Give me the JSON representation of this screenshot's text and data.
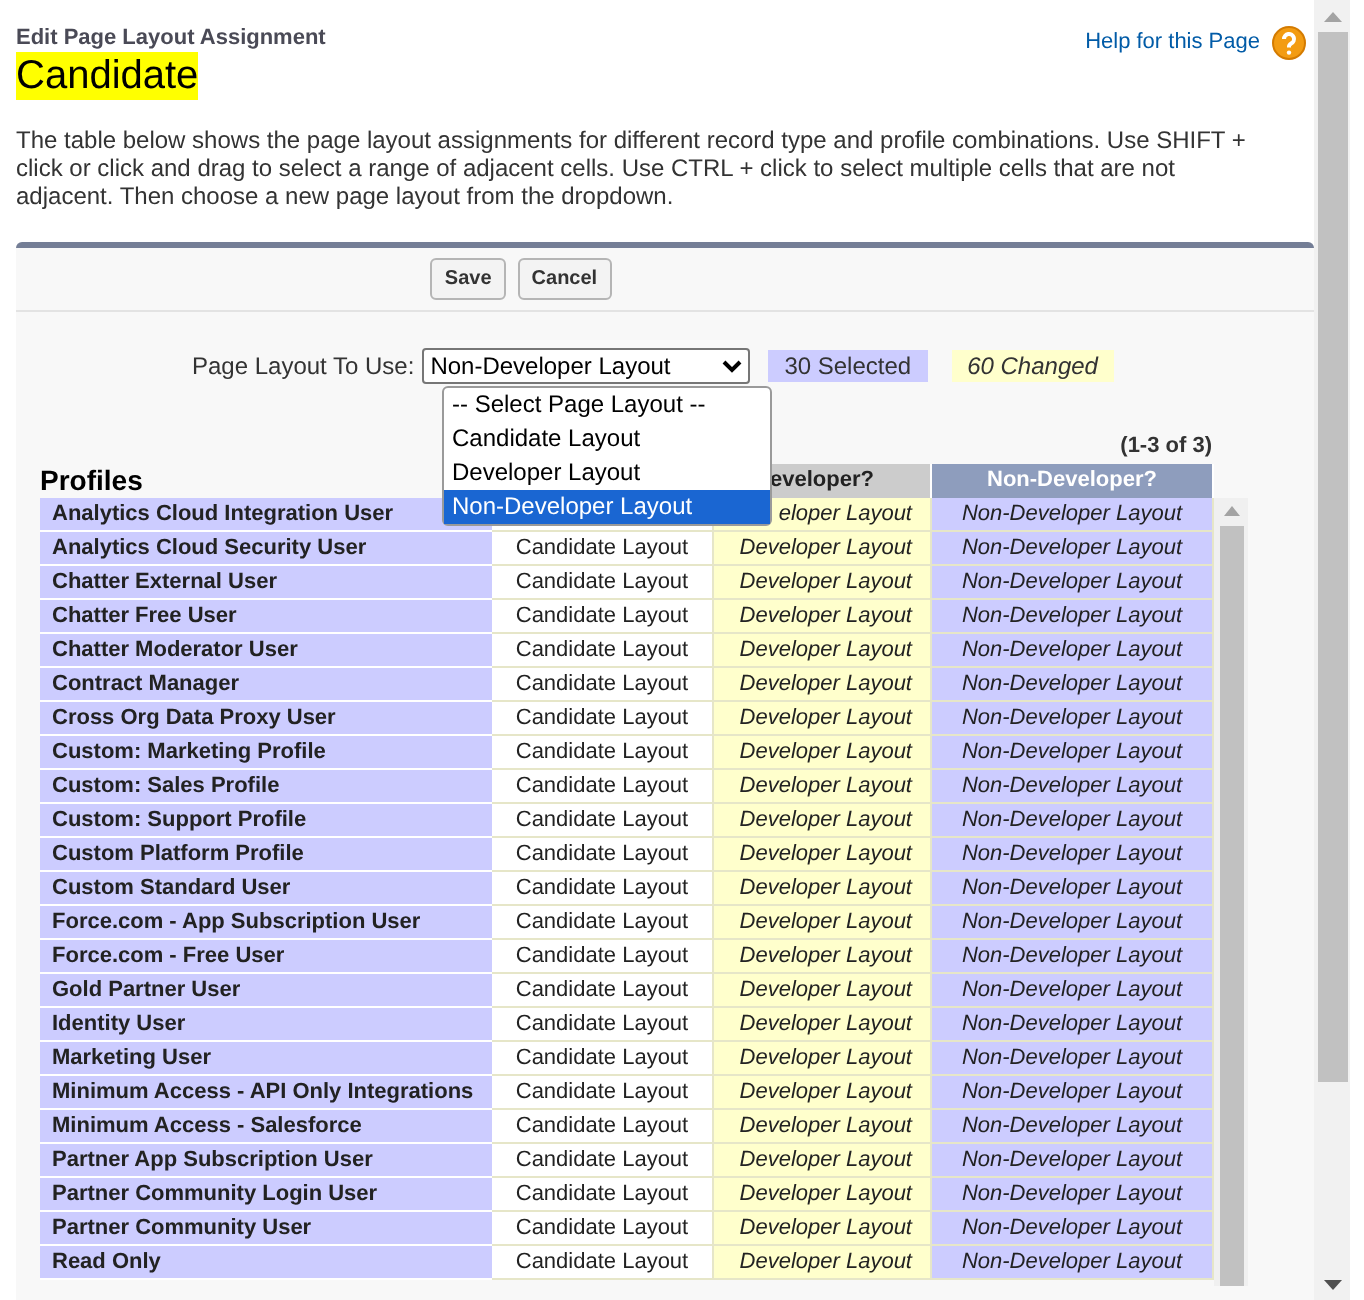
{
  "header": {
    "breadcrumb": "Edit Page Layout Assignment",
    "title": "Candidate",
    "help_link": "Help for this Page"
  },
  "description": "The table below shows the page layout assignments for different record type and profile combinations. Use SHIFT + click or click and drag to select a range of adjacent cells. Use CTRL + click to select multiple cells that are not adjacent. Then choose a new page layout from the dropdown.",
  "buttons": [
    "Save",
    "Cancel"
  ],
  "layout_picker": {
    "label": "Page Layout To Use:",
    "value": "Non-Developer Layout",
    "selected_count": "30 Selected",
    "changed_count": "60 Changed",
    "options": [
      {
        "label": "-- Select Page Layout --",
        "selected": false
      },
      {
        "label": "Candidate Layout",
        "selected": false
      },
      {
        "label": "Developer Layout",
        "selected": false
      },
      {
        "label": "Non-Developer Layout",
        "selected": true
      }
    ]
  },
  "pagination": "(1-3 of 3)",
  "table": {
    "profiles_heading": "Profiles",
    "columns": [
      {
        "selected": false,
        "changed": false
      },
      {
        "header": "eveloper?",
        "selected": false,
        "changed": true
      },
      {
        "header": "Non-Developer?",
        "selected": true,
        "changed": true
      }
    ],
    "rows": [
      {
        "profile": "Analytics Cloud Integration User",
        "cells": {
          "1": "eloper Layout",
          "2": "Non-Developer Layout"
        }
      },
      {
        "profile": "Analytics Cloud Security User",
        "cells": [
          "Candidate Layout",
          "Developer Layout",
          "Non-Developer Layout"
        ]
      },
      {
        "profile": "Chatter External User",
        "cells": [
          "Candidate Layout",
          "Developer Layout",
          "Non-Developer Layout"
        ]
      },
      {
        "profile": "Chatter Free User",
        "cells": [
          "Candidate Layout",
          "Developer Layout",
          "Non-Developer Layout"
        ]
      },
      {
        "profile": "Chatter Moderator User",
        "cells": [
          "Candidate Layout",
          "Developer Layout",
          "Non-Developer Layout"
        ]
      },
      {
        "profile": "Contract Manager",
        "cells": [
          "Candidate Layout",
          "Developer Layout",
          "Non-Developer Layout"
        ]
      },
      {
        "profile": "Cross Org Data Proxy User",
        "cells": [
          "Candidate Layout",
          "Developer Layout",
          "Non-Developer Layout"
        ]
      },
      {
        "profile": "Custom: Marketing Profile",
        "cells": [
          "Candidate Layout",
          "Developer Layout",
          "Non-Developer Layout"
        ]
      },
      {
        "profile": "Custom: Sales Profile",
        "cells": [
          "Candidate Layout",
          "Developer Layout",
          "Non-Developer Layout"
        ]
      },
      {
        "profile": "Custom: Support Profile",
        "cells": [
          "Candidate Layout",
          "Developer Layout",
          "Non-Developer Layout"
        ]
      },
      {
        "profile": "Custom Platform Profile",
        "cells": [
          "Candidate Layout",
          "Developer Layout",
          "Non-Developer Layout"
        ]
      },
      {
        "profile": "Custom Standard User",
        "cells": [
          "Candidate Layout",
          "Developer Layout",
          "Non-Developer Layout"
        ]
      },
      {
        "profile": "Force.com - App Subscription User",
        "cells": [
          "Candidate Layout",
          "Developer Layout",
          "Non-Developer Layout"
        ]
      },
      {
        "profile": "Force.com - Free User",
        "cells": [
          "Candidate Layout",
          "Developer Layout",
          "Non-Developer Layout"
        ]
      },
      {
        "profile": "Gold Partner User",
        "cells": [
          "Candidate Layout",
          "Developer Layout",
          "Non-Developer Layout"
        ]
      },
      {
        "profile": "Identity User",
        "cells": [
          "Candidate Layout",
          "Developer Layout",
          "Non-Developer Layout"
        ]
      },
      {
        "profile": "Marketing User",
        "cells": [
          "Candidate Layout",
          "Developer Layout",
          "Non-Developer Layout"
        ]
      },
      {
        "profile": "Minimum Access - API Only Integrations",
        "cells": [
          "Candidate Layout",
          "Developer Layout",
          "Non-Developer Layout"
        ]
      },
      {
        "profile": "Minimum Access - Salesforce",
        "cells": [
          "Candidate Layout",
          "Developer Layout",
          "Non-Developer Layout"
        ]
      },
      {
        "profile": "Partner App Subscription User",
        "cells": [
          "Candidate Layout",
          "Developer Layout",
          "Non-Developer Layout"
        ]
      },
      {
        "profile": "Partner Community Login User",
        "cells": [
          "Candidate Layout",
          "Developer Layout",
          "Non-Developer Layout"
        ]
      },
      {
        "profile": "Partner Community User",
        "cells": [
          "Candidate Layout",
          "Developer Layout",
          "Non-Developer Layout"
        ]
      },
      {
        "profile": "Read Only",
        "cells": [
          "Candidate Layout",
          "Developer Layout",
          "Non-Developer Layout"
        ]
      }
    ]
  }
}
